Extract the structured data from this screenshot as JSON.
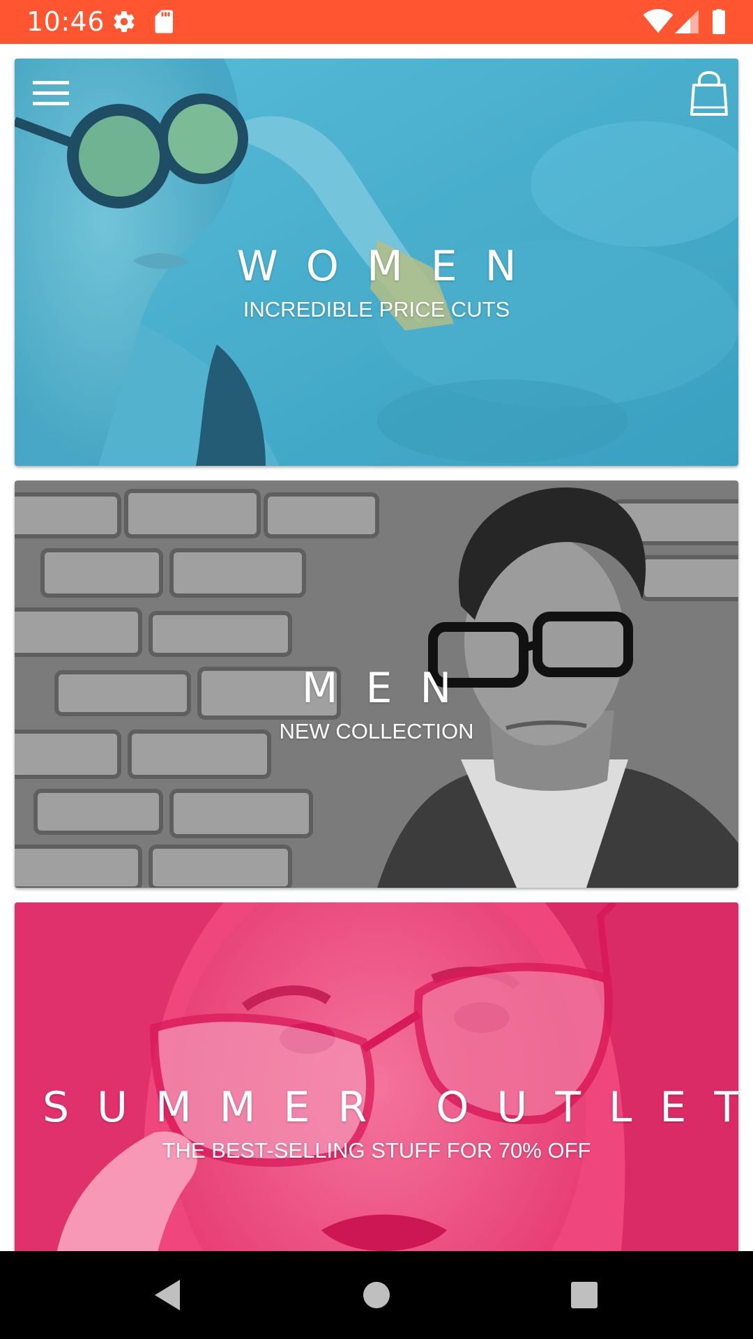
{
  "status_bar": {
    "time": "10:46",
    "background": "#ff5530",
    "icons_left": [
      "settings-gear-icon",
      "sd-card-icon"
    ],
    "icons_right": [
      "wifi-icon",
      "cellular-signal-icon",
      "battery-icon"
    ]
  },
  "toolbar": {
    "menu_icon": "hamburger-menu-icon",
    "cart_icon": "shopping-bag-icon"
  },
  "cards": [
    {
      "id": "women",
      "title": "WOMEN",
      "subtitle": "INCREDIBLE PRICE CUTS",
      "overlay_color": "#3fa9c9"
    },
    {
      "id": "men",
      "title": "MEN",
      "subtitle": "NEW COLLECTION",
      "overlay_color": "#7a7a7a"
    },
    {
      "id": "summer-outlet",
      "title": "SUMMER OUTLET",
      "subtitle": "THE BEST-SELLING STUFF FOR 70% OFF",
      "overlay_color": "#f0467e"
    }
  ],
  "navigation_bar": {
    "buttons": [
      "back-icon",
      "home-icon",
      "recents-icon"
    ]
  }
}
